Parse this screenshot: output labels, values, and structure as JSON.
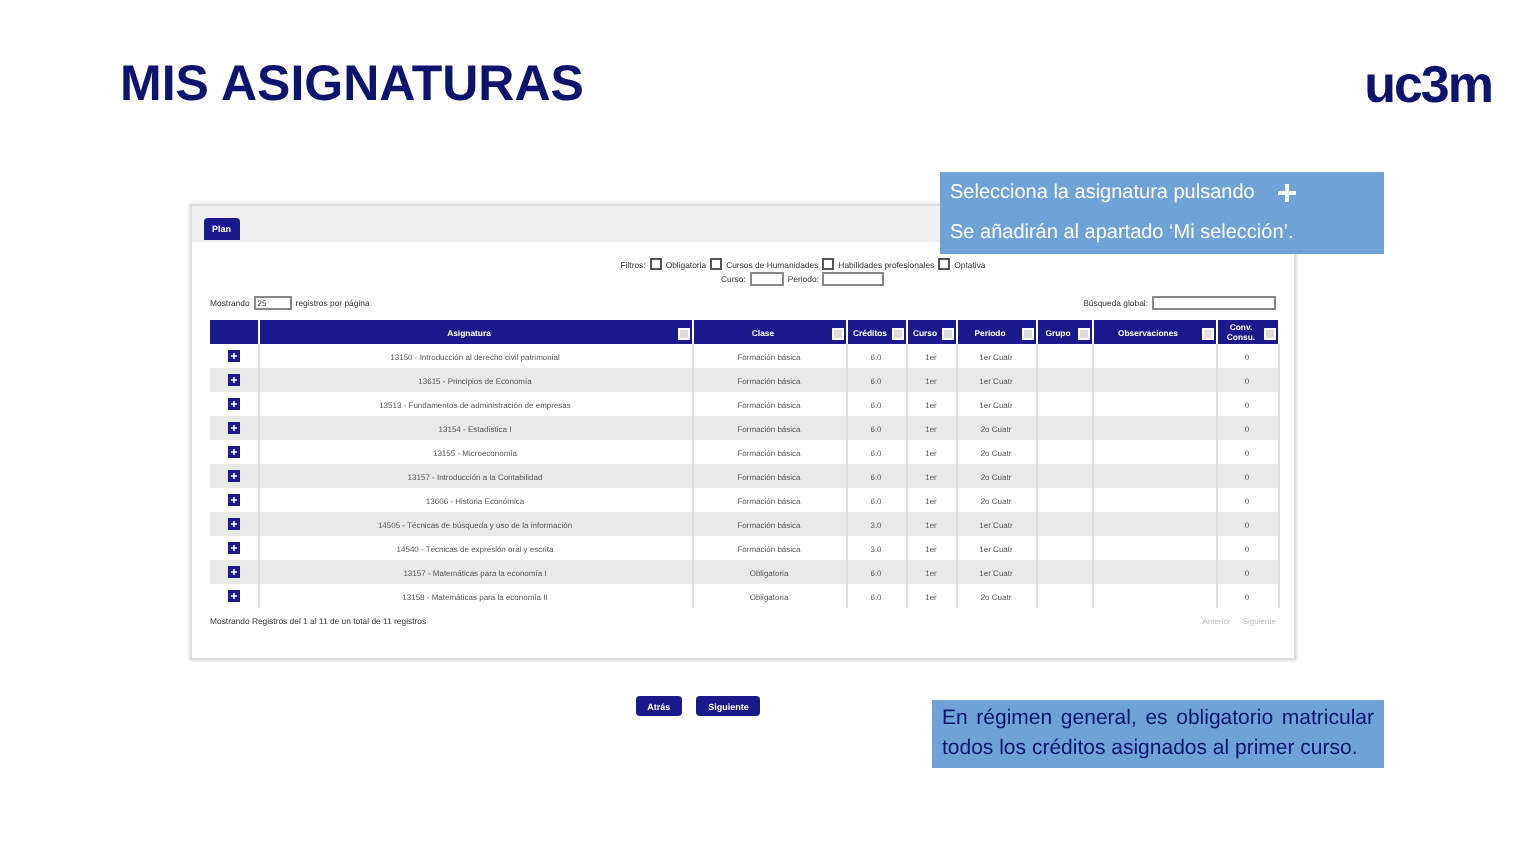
{
  "slide_title": "MIS ASIGNATURAS",
  "logo": "uc3m",
  "tabs": [
    {
      "label": "Plan",
      "selected": true
    }
  ],
  "filters": {
    "label": "Filtros:",
    "options": [
      {
        "label": "Obligatoria",
        "checked": false
      },
      {
        "label": "Cursos de Humanidades",
        "checked": false
      },
      {
        "label": "Habilidades profesionales",
        "checked": false
      },
      {
        "label": "Optativa",
        "checked": false
      }
    ],
    "curso_label": "Curso:",
    "periodo_label": "Periodo:"
  },
  "page_size": {
    "before": "Mostrando",
    "value": "25",
    "after": "registros por página"
  },
  "search": {
    "label": "Búsqueda global:"
  },
  "table": {
    "columns": [
      "Asignatura",
      "Clase",
      "Créditos",
      "Curso",
      "Periodo",
      "Grupo",
      "Observaciones",
      "Conv. Consu."
    ],
    "rows": [
      [
        "13150 - Introducción al derecho civil patrimonial",
        "Formación básica",
        "6.0",
        "1er",
        "1er Cuatr",
        "",
        "",
        "0"
      ],
      [
        "13615 - Principios de Economía",
        "Formación básica",
        "6.0",
        "1er",
        "1er Cuatr",
        "",
        "",
        "0"
      ],
      [
        "13513 - Fundamentos de administración de empresas",
        "Formación básica",
        "6.0",
        "1er",
        "1er Cuatr",
        "",
        "",
        "0"
      ],
      [
        "13154 - Estadística I",
        "Formación básica",
        "6.0",
        "1er",
        "2o Cuatr",
        "",
        "",
        "0"
      ],
      [
        "13155 - Microeconomía",
        "Formación básica",
        "6.0",
        "1er",
        "2o Cuatr",
        "",
        "",
        "0"
      ],
      [
        "13157 - Introducción a la Contabilidad",
        "Formación básica",
        "6.0",
        "1er",
        "2o Cuatr",
        "",
        "",
        "0"
      ],
      [
        "13606 - Historia Económica",
        "Formación básica",
        "6.0",
        "1er",
        "2o Cuatr",
        "",
        "",
        "0"
      ],
      [
        "14505 - Técnicas de búsqueda y uso de la información",
        "Formación básica",
        "3.0",
        "1er",
        "1er Cuatr",
        "",
        "",
        "0"
      ],
      [
        "14540 - Técnicas de expresión oral y escrita",
        "Formación básica",
        "3.0",
        "1er",
        "1er Cuatr",
        "",
        "",
        "0"
      ],
      [
        "13157 - Matemáticas para la economía I",
        "Obligatoria",
        "6.0",
        "1er",
        "1er Cuatr",
        "",
        "",
        "0"
      ],
      [
        "13158 - Matemáticas para la economía II",
        "Obligatoria",
        "6.0",
        "1er",
        "2o Cuatr",
        "",
        "",
        "0"
      ]
    ]
  },
  "info": "Mostrando Registros del 1 al 11 de un total de 11 registros",
  "pagination": [
    {
      "label": "Anterior",
      "disabled": true
    },
    {
      "label": "Siguiente",
      "disabled": true
    }
  ],
  "nav_buttons": [
    "Atrás",
    "Siguiente"
  ],
  "callout_top": [
    "Selecciona la asignatura pulsando",
    "Se añadirán al apartado ‘Mi selección’."
  ],
  "callout_bottom": "En régimen general, es obligatorio matricular todos los créditos asignados al primer curso."
}
